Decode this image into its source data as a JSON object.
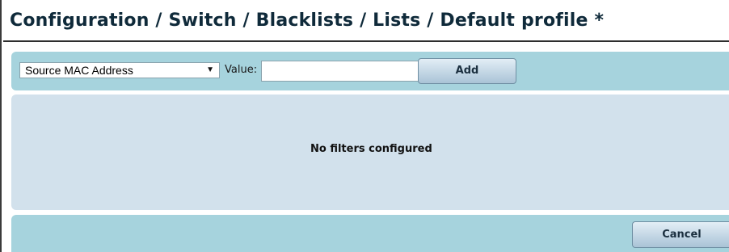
{
  "header": {
    "title": "Configuration / Switch / Blacklists / Lists / Default profile *"
  },
  "filter_bar": {
    "type_select": {
      "selected": "Source MAC Address",
      "caret": "▼"
    },
    "value_label": "Value:",
    "value_input": {
      "value": "",
      "placeholder": ""
    },
    "add_label": "Add"
  },
  "filter_list": {
    "empty_message": "No filters configured"
  },
  "footer": {
    "cancel_label": "Cancel"
  },
  "colors": {
    "bar_background": "#a6d3dd",
    "list_background": "#d2e1ec",
    "title_color": "#0f2a3a"
  }
}
